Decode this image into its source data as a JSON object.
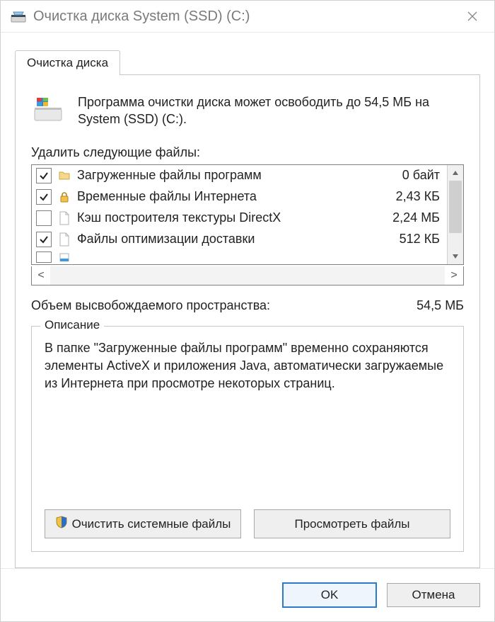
{
  "titlebar": {
    "icon_name": "disk-cleanup-icon",
    "title": "Очистка диска System (SSD) (C:)"
  },
  "tab": {
    "label": "Очистка диска"
  },
  "intro": {
    "text": "Программа очистки диска может освободить до 54,5 МБ на System (SSD) (C:)."
  },
  "files": {
    "label": "Удалить следующие файлы:",
    "items": [
      {
        "checked": true,
        "icon": "folder-icon",
        "label": "Загруженные файлы программ",
        "size": "0 байт"
      },
      {
        "checked": true,
        "icon": "lock-icon",
        "label": "Временные файлы Интернета",
        "size": "2,43 КБ"
      },
      {
        "checked": false,
        "icon": "file-icon",
        "label": "Кэш построителя текстуры DirectX",
        "size": "2,24 МБ"
      },
      {
        "checked": true,
        "icon": "file-icon",
        "label": "Файлы оптимизации доставки",
        "size": "512 КБ"
      }
    ]
  },
  "total": {
    "label": "Объем высвобождаемого пространства:",
    "value": "54,5 МБ"
  },
  "description": {
    "legend": "Описание",
    "text": "В папке \"Загруженные файлы программ\" временно сохраняются элементы ActiveX и приложения Java, автоматически загружаемые из Интернета при просмотре некоторых страниц."
  },
  "buttons": {
    "clean_system": "Очистить системные файлы",
    "view_files": "Просмотреть файлы",
    "ok": "OK",
    "cancel": "Отмена"
  }
}
